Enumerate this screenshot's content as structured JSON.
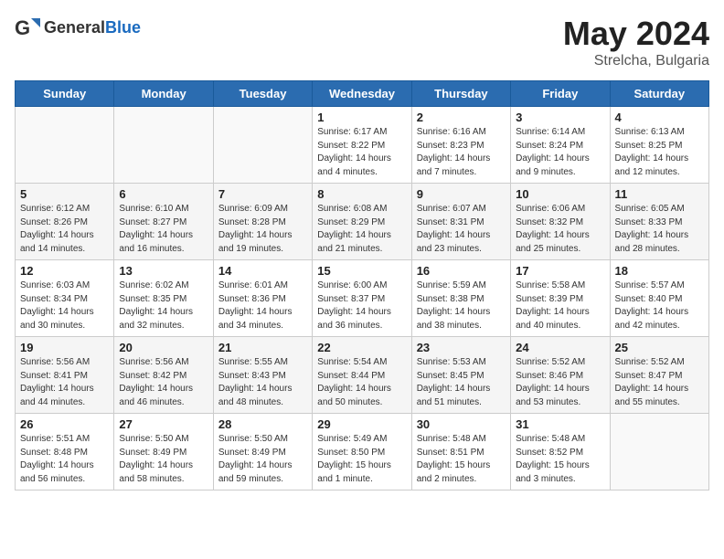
{
  "header": {
    "logo_general": "General",
    "logo_blue": "Blue",
    "title": "May 2024",
    "location": "Strelcha, Bulgaria"
  },
  "days_of_week": [
    "Sunday",
    "Monday",
    "Tuesday",
    "Wednesday",
    "Thursday",
    "Friday",
    "Saturday"
  ],
  "weeks": [
    {
      "alt": false,
      "days": [
        {
          "num": "",
          "info": ""
        },
        {
          "num": "",
          "info": ""
        },
        {
          "num": "",
          "info": ""
        },
        {
          "num": "1",
          "info": "Sunrise: 6:17 AM\nSunset: 8:22 PM\nDaylight: 14 hours\nand 4 minutes."
        },
        {
          "num": "2",
          "info": "Sunrise: 6:16 AM\nSunset: 8:23 PM\nDaylight: 14 hours\nand 7 minutes."
        },
        {
          "num": "3",
          "info": "Sunrise: 6:14 AM\nSunset: 8:24 PM\nDaylight: 14 hours\nand 9 minutes."
        },
        {
          "num": "4",
          "info": "Sunrise: 6:13 AM\nSunset: 8:25 PM\nDaylight: 14 hours\nand 12 minutes."
        }
      ]
    },
    {
      "alt": true,
      "days": [
        {
          "num": "5",
          "info": "Sunrise: 6:12 AM\nSunset: 8:26 PM\nDaylight: 14 hours\nand 14 minutes."
        },
        {
          "num": "6",
          "info": "Sunrise: 6:10 AM\nSunset: 8:27 PM\nDaylight: 14 hours\nand 16 minutes."
        },
        {
          "num": "7",
          "info": "Sunrise: 6:09 AM\nSunset: 8:28 PM\nDaylight: 14 hours\nand 19 minutes."
        },
        {
          "num": "8",
          "info": "Sunrise: 6:08 AM\nSunset: 8:29 PM\nDaylight: 14 hours\nand 21 minutes."
        },
        {
          "num": "9",
          "info": "Sunrise: 6:07 AM\nSunset: 8:31 PM\nDaylight: 14 hours\nand 23 minutes."
        },
        {
          "num": "10",
          "info": "Sunrise: 6:06 AM\nSunset: 8:32 PM\nDaylight: 14 hours\nand 25 minutes."
        },
        {
          "num": "11",
          "info": "Sunrise: 6:05 AM\nSunset: 8:33 PM\nDaylight: 14 hours\nand 28 minutes."
        }
      ]
    },
    {
      "alt": false,
      "days": [
        {
          "num": "12",
          "info": "Sunrise: 6:03 AM\nSunset: 8:34 PM\nDaylight: 14 hours\nand 30 minutes."
        },
        {
          "num": "13",
          "info": "Sunrise: 6:02 AM\nSunset: 8:35 PM\nDaylight: 14 hours\nand 32 minutes."
        },
        {
          "num": "14",
          "info": "Sunrise: 6:01 AM\nSunset: 8:36 PM\nDaylight: 14 hours\nand 34 minutes."
        },
        {
          "num": "15",
          "info": "Sunrise: 6:00 AM\nSunset: 8:37 PM\nDaylight: 14 hours\nand 36 minutes."
        },
        {
          "num": "16",
          "info": "Sunrise: 5:59 AM\nSunset: 8:38 PM\nDaylight: 14 hours\nand 38 minutes."
        },
        {
          "num": "17",
          "info": "Sunrise: 5:58 AM\nSunset: 8:39 PM\nDaylight: 14 hours\nand 40 minutes."
        },
        {
          "num": "18",
          "info": "Sunrise: 5:57 AM\nSunset: 8:40 PM\nDaylight: 14 hours\nand 42 minutes."
        }
      ]
    },
    {
      "alt": true,
      "days": [
        {
          "num": "19",
          "info": "Sunrise: 5:56 AM\nSunset: 8:41 PM\nDaylight: 14 hours\nand 44 minutes."
        },
        {
          "num": "20",
          "info": "Sunrise: 5:56 AM\nSunset: 8:42 PM\nDaylight: 14 hours\nand 46 minutes."
        },
        {
          "num": "21",
          "info": "Sunrise: 5:55 AM\nSunset: 8:43 PM\nDaylight: 14 hours\nand 48 minutes."
        },
        {
          "num": "22",
          "info": "Sunrise: 5:54 AM\nSunset: 8:44 PM\nDaylight: 14 hours\nand 50 minutes."
        },
        {
          "num": "23",
          "info": "Sunrise: 5:53 AM\nSunset: 8:45 PM\nDaylight: 14 hours\nand 51 minutes."
        },
        {
          "num": "24",
          "info": "Sunrise: 5:52 AM\nSunset: 8:46 PM\nDaylight: 14 hours\nand 53 minutes."
        },
        {
          "num": "25",
          "info": "Sunrise: 5:52 AM\nSunset: 8:47 PM\nDaylight: 14 hours\nand 55 minutes."
        }
      ]
    },
    {
      "alt": false,
      "days": [
        {
          "num": "26",
          "info": "Sunrise: 5:51 AM\nSunset: 8:48 PM\nDaylight: 14 hours\nand 56 minutes."
        },
        {
          "num": "27",
          "info": "Sunrise: 5:50 AM\nSunset: 8:49 PM\nDaylight: 14 hours\nand 58 minutes."
        },
        {
          "num": "28",
          "info": "Sunrise: 5:50 AM\nSunset: 8:49 PM\nDaylight: 14 hours\nand 59 minutes."
        },
        {
          "num": "29",
          "info": "Sunrise: 5:49 AM\nSunset: 8:50 PM\nDaylight: 15 hours\nand 1 minute."
        },
        {
          "num": "30",
          "info": "Sunrise: 5:48 AM\nSunset: 8:51 PM\nDaylight: 15 hours\nand 2 minutes."
        },
        {
          "num": "31",
          "info": "Sunrise: 5:48 AM\nSunset: 8:52 PM\nDaylight: 15 hours\nand 3 minutes."
        },
        {
          "num": "",
          "info": ""
        }
      ]
    }
  ]
}
